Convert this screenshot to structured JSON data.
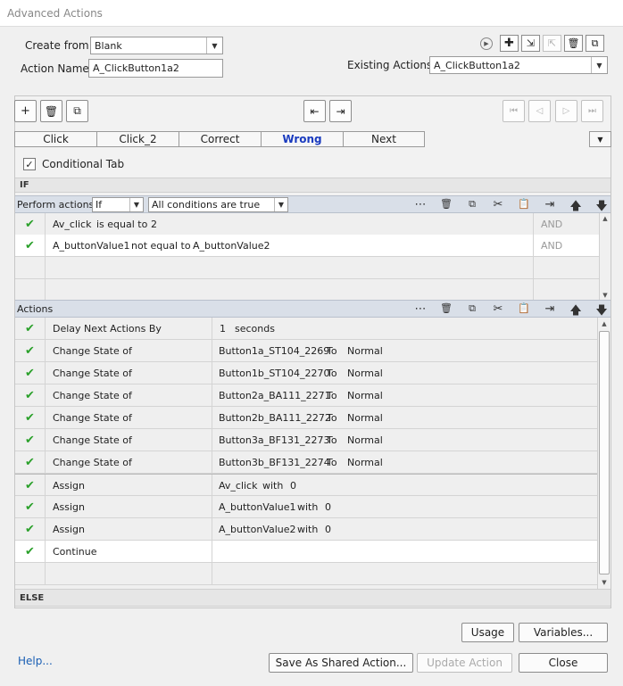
{
  "window": {
    "title": "Advanced Actions"
  },
  "top": {
    "create_from_label": "Create from:",
    "create_from_value": "Blank",
    "action_name_label": "Action Name:",
    "action_name_value": "A_ClickButton1a2",
    "existing_actions_label": "Existing Actions:",
    "existing_actions_value": "A_ClickButton1a2"
  },
  "tabs": [
    "Click",
    "Click_2",
    "Correct",
    "Wrong",
    "Next"
  ],
  "selected_tab": "Wrong",
  "conditional_tab_label": "Conditional Tab",
  "conditional_tab_checked": true,
  "if_section": {
    "label": "IF"
  },
  "perform": {
    "label": "Perform actions:",
    "mode": "If",
    "conditions_mode": "All conditions are true"
  },
  "conditions": [
    {
      "left": "Av_click",
      "op": "is equal to",
      "right": "2",
      "logic": "AND"
    },
    {
      "left": "A_buttonValue1",
      "op": "not equal to",
      "right": "A_buttonValue2",
      "logic": "AND"
    }
  ],
  "actions_header": "Actions",
  "actions": [
    {
      "action": "Delay Next Actions By",
      "target": "1",
      "mid": "seconds",
      "value": ""
    },
    {
      "action": "Change State of",
      "target": "Button1a_ST104_2269",
      "mid": "To",
      "value": "Normal"
    },
    {
      "action": "Change State of",
      "target": "Button1b_ST104_2270",
      "mid": "To",
      "value": "Normal"
    },
    {
      "action": "Change State of",
      "target": "Button2a_BA111_2271",
      "mid": "To",
      "value": "Normal"
    },
    {
      "action": "Change State of",
      "target": "Button2b_BA111_2272",
      "mid": "To",
      "value": "Normal"
    },
    {
      "action": "Change State of",
      "target": "Button3a_BF131_2273",
      "mid": "To",
      "value": "Normal"
    },
    {
      "action": "Change State of",
      "target": "Button3b_BF131_2274",
      "mid": "To",
      "value": "Normal"
    },
    {
      "action": "Assign",
      "target": "Av_click",
      "mid": "with",
      "value": "0"
    },
    {
      "action": "Assign",
      "target": "A_buttonValue1",
      "mid": "with",
      "value": "0"
    },
    {
      "action": "Assign",
      "target": "A_buttonValue2",
      "mid": "with",
      "value": "0"
    },
    {
      "action": "Continue",
      "target": "",
      "mid": "",
      "value": ""
    }
  ],
  "else_section": {
    "label": "ELSE"
  },
  "buttons": {
    "usage": "Usage",
    "variables": "Variables...",
    "help": "Help...",
    "save_shared": "Save As Shared Action...",
    "update": "Update Action",
    "close": "Close"
  },
  "colors": {
    "check": "#2aa02a",
    "selected_tab": "#1a3bbf",
    "grid_header": "#d9dfe8",
    "link": "#1a5fb4"
  }
}
